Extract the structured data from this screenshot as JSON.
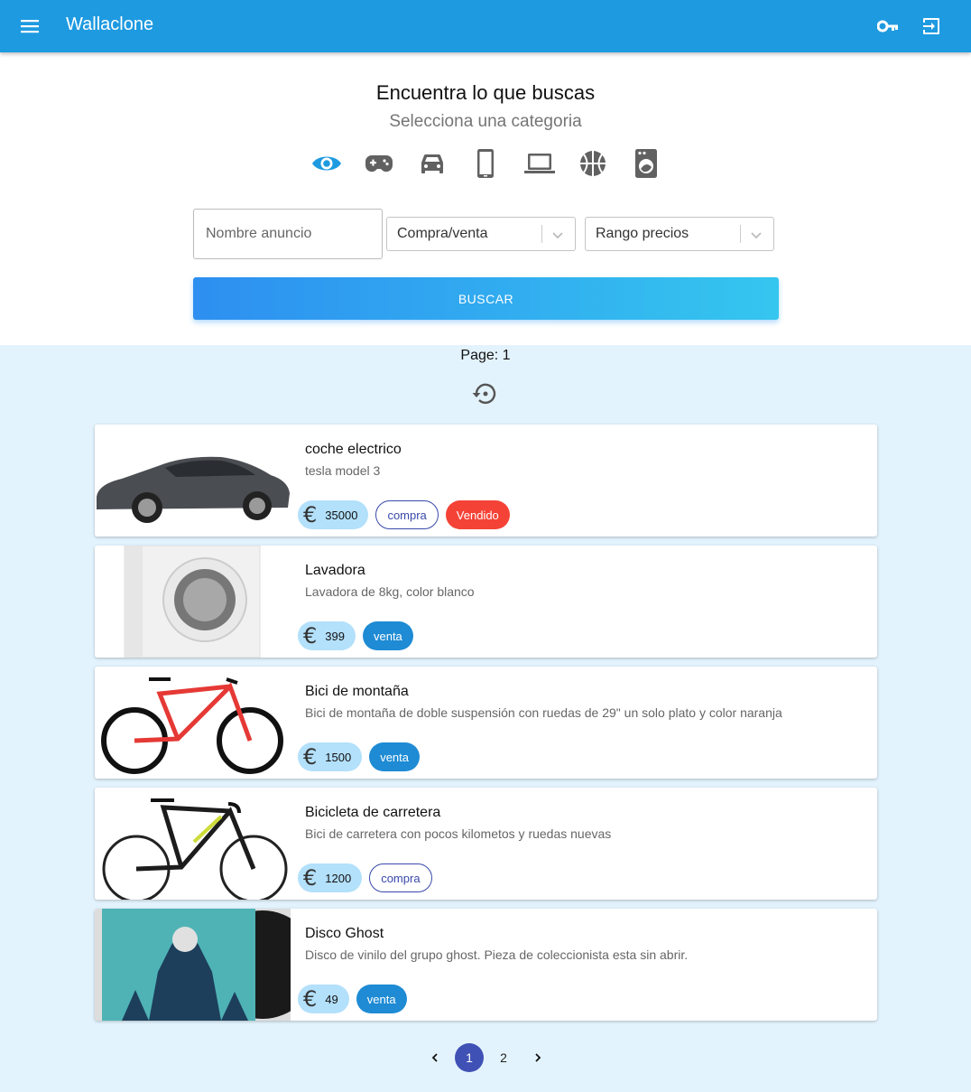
{
  "app": {
    "title": "Wallaclone"
  },
  "header": {
    "heading": "Encuentra lo que buscas",
    "subheading": "Selecciona una categoria",
    "categories": [
      "eye-icon",
      "gamepad-icon",
      "car-icon",
      "smartphone-icon",
      "laptop-icon",
      "sports-ball-icon",
      "washing-machine-icon"
    ]
  },
  "search": {
    "name_placeholder": "Nombre anuncio",
    "type_select": "Compra/venta",
    "price_select": "Rango precios",
    "button_label": "BUSCAR"
  },
  "results": {
    "page_label": "Page: 1",
    "items": [
      {
        "title": "coche electrico",
        "description": "tesla model 3",
        "price": "35000",
        "type": "compra",
        "status": "Vendido"
      },
      {
        "title": "Lavadora",
        "description": "Lavadora de 8kg, color blanco",
        "price": "399",
        "type": "venta",
        "status": ""
      },
      {
        "title": "Bici de montaña",
        "description": "Bici de montaña de doble suspensión con ruedas de 29\" un solo plato y color naranja",
        "price": "1500",
        "type": "venta",
        "status": ""
      },
      {
        "title": "Bicicleta de carretera",
        "description": "Bici de carretera con pocos kilometos y ruedas nuevas",
        "price": "1200",
        "type": "compra",
        "status": ""
      },
      {
        "title": "Disco Ghost",
        "description": "Disco de vinilo del grupo ghost. Pieza de coleccionista esta sin abrir.",
        "price": "49",
        "type": "venta",
        "status": ""
      }
    ]
  },
  "pagination": {
    "pages": [
      "1",
      "2"
    ],
    "current": "1"
  },
  "colors": {
    "appbar": "#1e9ae0",
    "venta": "#1e8bd4",
    "vendido": "#f44336",
    "compra_border": "#3949ab",
    "page_bg": "#e3f3fd"
  }
}
